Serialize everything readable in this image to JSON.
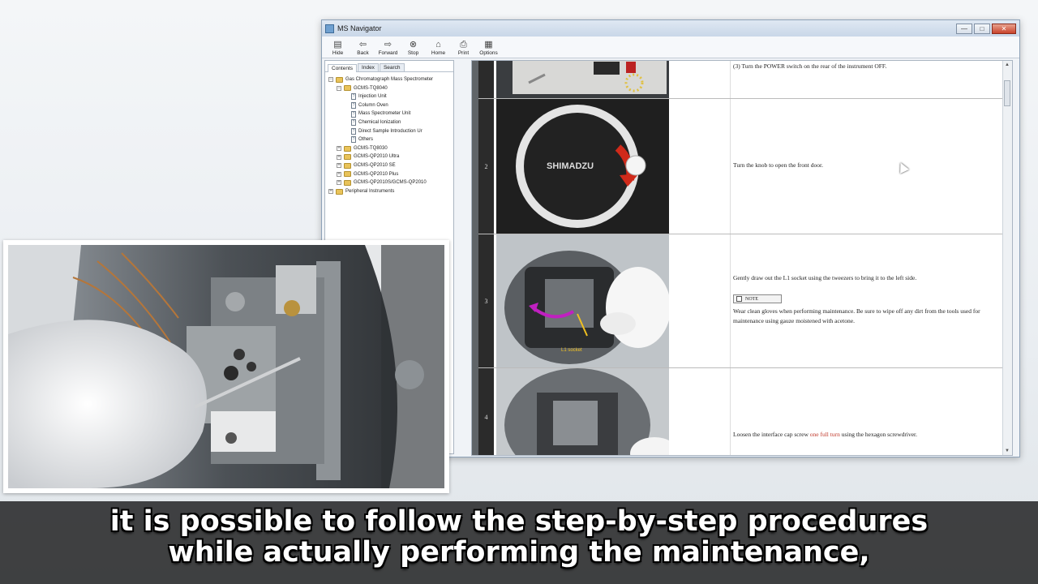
{
  "window": {
    "title": "MS Navigator",
    "buttons": {
      "minimize": "—",
      "maximize": "□",
      "close": "✕"
    }
  },
  "toolbar": [
    {
      "label": "Hide",
      "icon": "hide-icon"
    },
    {
      "label": "Back",
      "icon": "back-arrow-icon"
    },
    {
      "label": "Forward",
      "icon": "forward-arrow-icon"
    },
    {
      "label": "Stop",
      "icon": "stop-icon"
    },
    {
      "label": "Home",
      "icon": "home-icon"
    },
    {
      "label": "Print",
      "icon": "print-icon"
    },
    {
      "label": "Options",
      "icon": "options-icon"
    }
  ],
  "nav": {
    "tabs": [
      "Contents",
      "Index",
      "Search"
    ],
    "tree": {
      "root": "Gas Chromatograph Mass Spectrometer",
      "tq8040": "GCMS-TQ8040",
      "tq8040_children": [
        "Injection Unit",
        "Column Oven",
        "Mass Spectrometer Unit",
        "Chemical Ionization",
        "Direct Sample Introduction Ur",
        "Others"
      ],
      "other_models": [
        "GCMS-TQ8030",
        "GCMS-QP2010 Ultra",
        "GCMS-QP2010 SE",
        "GCMS-QP2010 Plus",
        "GCMS-QP2010S/GCMS-QP2010"
      ],
      "peripheral": "Peripheral Instruments"
    }
  },
  "steps": [
    {
      "num": "",
      "text": "(3) Turn the POWER switch on the rear of the instrument OFF."
    },
    {
      "num": "2",
      "text": "Turn the knob to open the front door."
    },
    {
      "num": "3",
      "text": "Gently draw out the L1 socket using the tweezers to bring it to the left side.",
      "note_label": "NOTE",
      "note_text": "Wear clean gloves when performing maintenance. Be sure to wipe off any dirt from the tools used for maintenance using gauze moistened with acetone.",
      "image_label": "L1 socket"
    },
    {
      "num": "4",
      "text_before": "Loosen the interface cap screw ",
      "text_highlight": "one full turn",
      "text_after": " using the hexagon screwdriver."
    }
  ],
  "image_labels": {
    "brand": "SHIMADZU"
  },
  "caption": {
    "line1": "it is possible to follow the step-by-step procedures",
    "line2": "while actually performing the maintenance,"
  },
  "colors": {
    "highlight_red": "#c0392b",
    "caption_bg": "#000000"
  }
}
